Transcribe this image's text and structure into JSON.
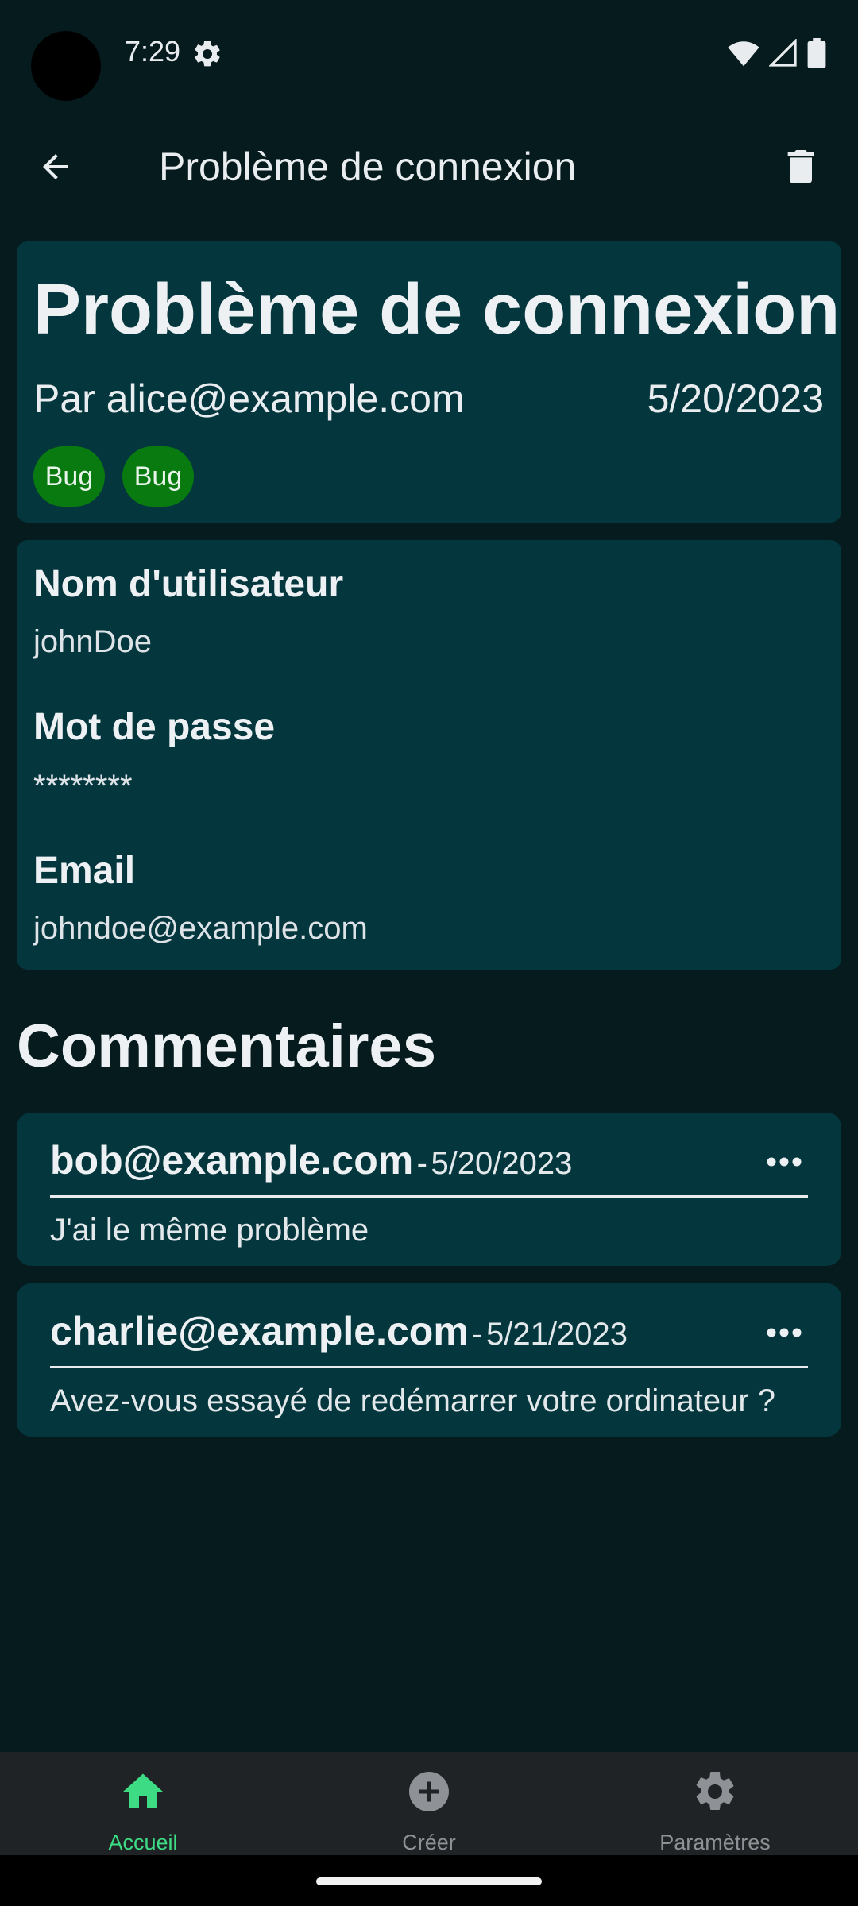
{
  "status_bar": {
    "time": "7:29"
  },
  "app_bar": {
    "title": "Problème de connexion"
  },
  "ticket": {
    "title": "Problème de connexion",
    "author": "Par alice@example.com",
    "date": "5/20/2023",
    "tags": [
      "Bug",
      "Bug"
    ]
  },
  "details": {
    "username_label": "Nom d'utilisateur",
    "username_value": "johnDoe",
    "password_label": "Mot de passe",
    "password_value": "********",
    "email_label": "Email",
    "email_value": "johndoe@example.com"
  },
  "comments_section": {
    "title": "Commentaires",
    "separator": "-",
    "items": [
      {
        "author": "bob@example.com",
        "date": "5/20/2023",
        "text": "J'ai le même problème"
      },
      {
        "author": "charlie@example.com",
        "date": "5/21/2023",
        "text": "Avez-vous essayé de redémarrer votre ordinateur ?"
      }
    ]
  },
  "bottom_nav": {
    "items": [
      {
        "label": "Accueil",
        "icon": "home-icon",
        "active": true
      },
      {
        "label": "Créer",
        "icon": "add-circle-icon",
        "active": false
      },
      {
        "label": "Paramètres",
        "icon": "settings-icon",
        "active": false
      }
    ]
  },
  "colors": {
    "background": "#051b1e",
    "card": "#04363d",
    "tag": "#097a10",
    "accent": "#3ddc84",
    "nav_bar": "#1f2326"
  }
}
